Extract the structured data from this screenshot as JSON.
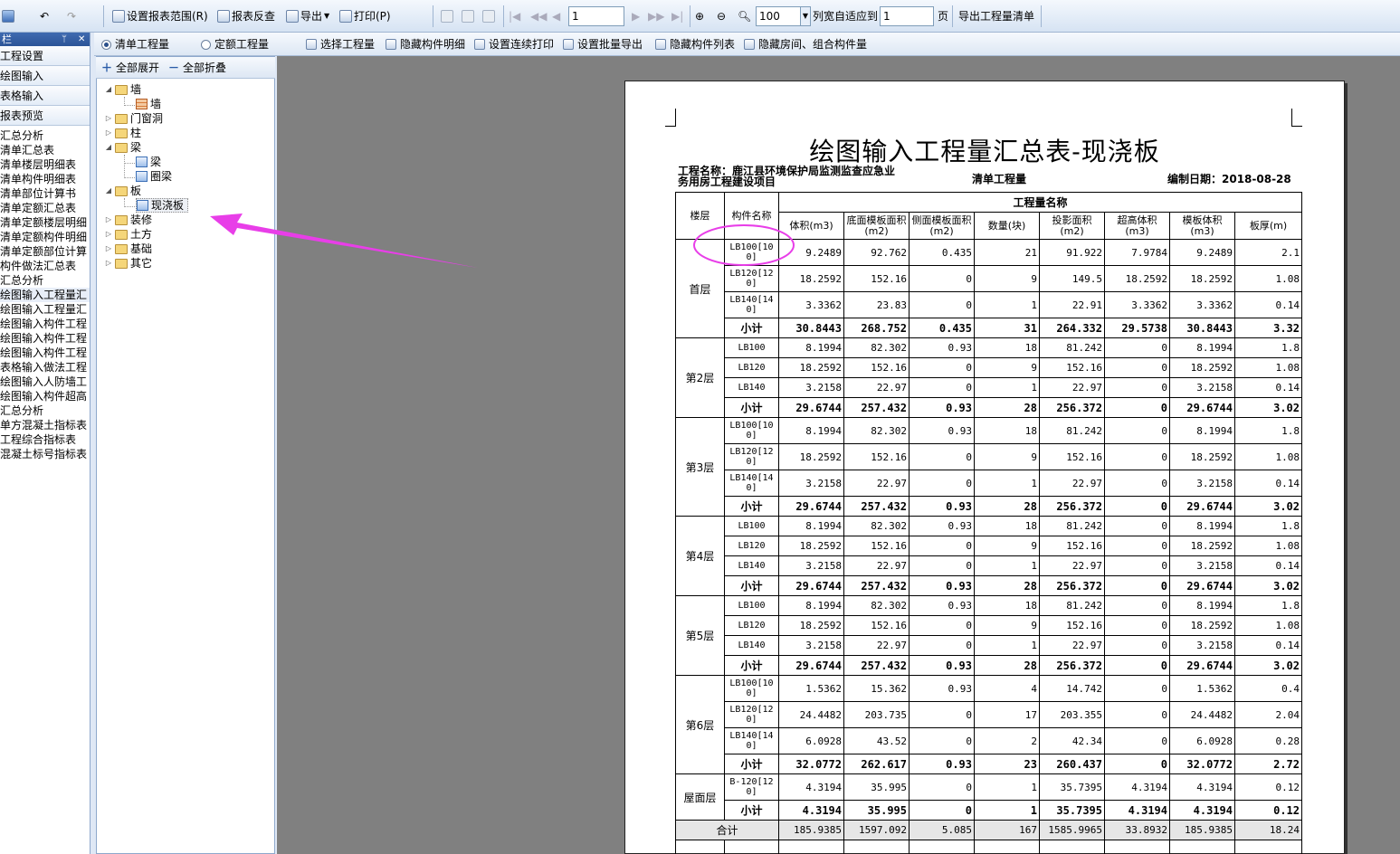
{
  "toolbar": {
    "set_range": "设置报表范围(R)",
    "report_check": "报表反查",
    "export": "导出",
    "print": "打印(P)",
    "page_value": "1",
    "zoom_value": "100",
    "fit_label": "列宽自适应到",
    "fit_value": "1",
    "fit_unit": "页",
    "export_list": "导出工程量清单"
  },
  "left_panel": {
    "title": "栏",
    "nav": [
      "工程设置",
      "绘图输入",
      "表格输入",
      "报表预览"
    ],
    "items": [
      "汇总分析",
      "清单汇总表",
      "清单楼层明细表",
      "清单构件明细表",
      "清单部位计算书",
      "清单定额汇总表",
      "清单定额楼层明细",
      "清单定额构件明细",
      "清单定额部位计算",
      "构件做法汇总表",
      "汇总分析",
      "绘图输入工程量汇",
      "绘图输入工程量汇",
      "绘图输入构件工程",
      "绘图输入构件工程",
      "绘图输入构件工程",
      "表格输入做法工程",
      "绘图输入人防墙工",
      "绘图输入构件超高",
      "汇总分析",
      "单方混凝土指标表",
      "工程综合指标表",
      "混凝土标号指标表"
    ]
  },
  "subbar": {
    "radio_list": "清单工程量",
    "radio_quota": "定额工程量",
    "select_qty": "选择工程量",
    "hide_detail": "隐藏构件明细",
    "continuous_print": "设置连续打印",
    "batch_export": "设置批量导出",
    "hide_list": "隐藏构件列表",
    "hide_room": "隐藏房间、组合构件量"
  },
  "tree": {
    "expand_all": "全部展开",
    "collapse_all": "全部折叠",
    "wall": "墙",
    "wall_child": "墙",
    "door_window": "门窗洞",
    "column": "柱",
    "beam": "梁",
    "beam_child": "梁",
    "ring_beam": "圈梁",
    "slab": "板",
    "slab_child": "现浇板",
    "decoration": "装修",
    "earthwork": "土方",
    "foundation": "基础",
    "other": "其它"
  },
  "report": {
    "title": "绘图输入工程量汇总表-现浇板",
    "project_name": "工程名称：鹿江县环境保护局监测监查应急业务用房工程建设项目",
    "qty_type": "清单工程量",
    "date": "编制日期：2018-08-28",
    "header": {
      "floor": "楼层",
      "component": "构件名称",
      "group": "工程量名称",
      "cols": [
        "体积(m3)",
        "底面模板面积(m2)",
        "侧面模板面积(m2)",
        "数量(块)",
        "投影面积(m2)",
        "超高体积(m3)",
        "模板体积(m3)",
        "板厚(m)"
      ]
    },
    "subtotal_label": "小计",
    "total_label": "合计",
    "floors": [
      {
        "name": "首层",
        "rows": [
          {
            "name": "LB100[100]",
            "vals": [
              "9.2489",
              "92.762",
              "0.435",
              "21",
              "91.922",
              "7.9784",
              "9.2489",
              "2.1"
            ]
          },
          {
            "name": "LB120[120]",
            "vals": [
              "18.2592",
              "152.16",
              "0",
              "9",
              "149.5",
              "18.2592",
              "18.2592",
              "1.08"
            ]
          },
          {
            "name": "LB140[140]",
            "vals": [
              "3.3362",
              "23.83",
              "0",
              "1",
              "22.91",
              "3.3362",
              "3.3362",
              "0.14"
            ]
          }
        ],
        "subtotal": [
          "30.8443",
          "268.752",
          "0.435",
          "31",
          "264.332",
          "29.5738",
          "30.8443",
          "3.32"
        ]
      },
      {
        "name": "第2层",
        "rows": [
          {
            "name": "LB100",
            "vals": [
              "8.1994",
              "82.302",
              "0.93",
              "18",
              "81.242",
              "0",
              "8.1994",
              "1.8"
            ]
          },
          {
            "name": "LB120",
            "vals": [
              "18.2592",
              "152.16",
              "0",
              "9",
              "152.16",
              "0",
              "18.2592",
              "1.08"
            ]
          },
          {
            "name": "LB140",
            "vals": [
              "3.2158",
              "22.97",
              "0",
              "1",
              "22.97",
              "0",
              "3.2158",
              "0.14"
            ]
          }
        ],
        "subtotal": [
          "29.6744",
          "257.432",
          "0.93",
          "28",
          "256.372",
          "0",
          "29.6744",
          "3.02"
        ]
      },
      {
        "name": "第3层",
        "rows": [
          {
            "name": "LB100[100]",
            "vals": [
              "8.1994",
              "82.302",
              "0.93",
              "18",
              "81.242",
              "0",
              "8.1994",
              "1.8"
            ]
          },
          {
            "name": "LB120[120]",
            "vals": [
              "18.2592",
              "152.16",
              "0",
              "9",
              "152.16",
              "0",
              "18.2592",
              "1.08"
            ]
          },
          {
            "name": "LB140[140]",
            "vals": [
              "3.2158",
              "22.97",
              "0",
              "1",
              "22.97",
              "0",
              "3.2158",
              "0.14"
            ]
          }
        ],
        "subtotal": [
          "29.6744",
          "257.432",
          "0.93",
          "28",
          "256.372",
          "0",
          "29.6744",
          "3.02"
        ]
      },
      {
        "name": "第4层",
        "rows": [
          {
            "name": "LB100",
            "vals": [
              "8.1994",
              "82.302",
              "0.93",
              "18",
              "81.242",
              "0",
              "8.1994",
              "1.8"
            ]
          },
          {
            "name": "LB120",
            "vals": [
              "18.2592",
              "152.16",
              "0",
              "9",
              "152.16",
              "0",
              "18.2592",
              "1.08"
            ]
          },
          {
            "name": "LB140",
            "vals": [
              "3.2158",
              "22.97",
              "0",
              "1",
              "22.97",
              "0",
              "3.2158",
              "0.14"
            ]
          }
        ],
        "subtotal": [
          "29.6744",
          "257.432",
          "0.93",
          "28",
          "256.372",
          "0",
          "29.6744",
          "3.02"
        ]
      },
      {
        "name": "第5层",
        "rows": [
          {
            "name": "LB100",
            "vals": [
              "8.1994",
              "82.302",
              "0.93",
              "18",
              "81.242",
              "0",
              "8.1994",
              "1.8"
            ]
          },
          {
            "name": "LB120",
            "vals": [
              "18.2592",
              "152.16",
              "0",
              "9",
              "152.16",
              "0",
              "18.2592",
              "1.08"
            ]
          },
          {
            "name": "LB140",
            "vals": [
              "3.2158",
              "22.97",
              "0",
              "1",
              "22.97",
              "0",
              "3.2158",
              "0.14"
            ]
          }
        ],
        "subtotal": [
          "29.6744",
          "257.432",
          "0.93",
          "28",
          "256.372",
          "0",
          "29.6744",
          "3.02"
        ]
      },
      {
        "name": "第6层",
        "rows": [
          {
            "name": "LB100[100]",
            "vals": [
              "1.5362",
              "15.362",
              "0.93",
              "4",
              "14.742",
              "0",
              "1.5362",
              "0.4"
            ]
          },
          {
            "name": "LB120[120]",
            "vals": [
              "24.4482",
              "203.735",
              "0",
              "17",
              "203.355",
              "0",
              "24.4482",
              "2.04"
            ]
          },
          {
            "name": "LB140[140]",
            "vals": [
              "6.0928",
              "43.52",
              "0",
              "2",
              "42.34",
              "0",
              "6.0928",
              "0.28"
            ]
          }
        ],
        "subtotal": [
          "32.0772",
          "262.617",
          "0.93",
          "23",
          "260.437",
          "0",
          "32.0772",
          "2.72"
        ]
      },
      {
        "name": "屋面层",
        "rows": [
          {
            "name": "B-120[120]",
            "vals": [
              "4.3194",
              "35.995",
              "0",
              "1",
              "35.7395",
              "4.3194",
              "4.3194",
              "0.12"
            ]
          }
        ],
        "subtotal": [
          "4.3194",
          "35.995",
          "0",
          "1",
          "35.7395",
          "4.3194",
          "4.3194",
          "0.12"
        ]
      }
    ],
    "total": [
      "185.9385",
      "1597.092",
      "5.085",
      "167",
      "1585.9965",
      "33.8932",
      "185.9385",
      "18.24"
    ]
  },
  "colors": {
    "annotation": "#e83ee8"
  }
}
